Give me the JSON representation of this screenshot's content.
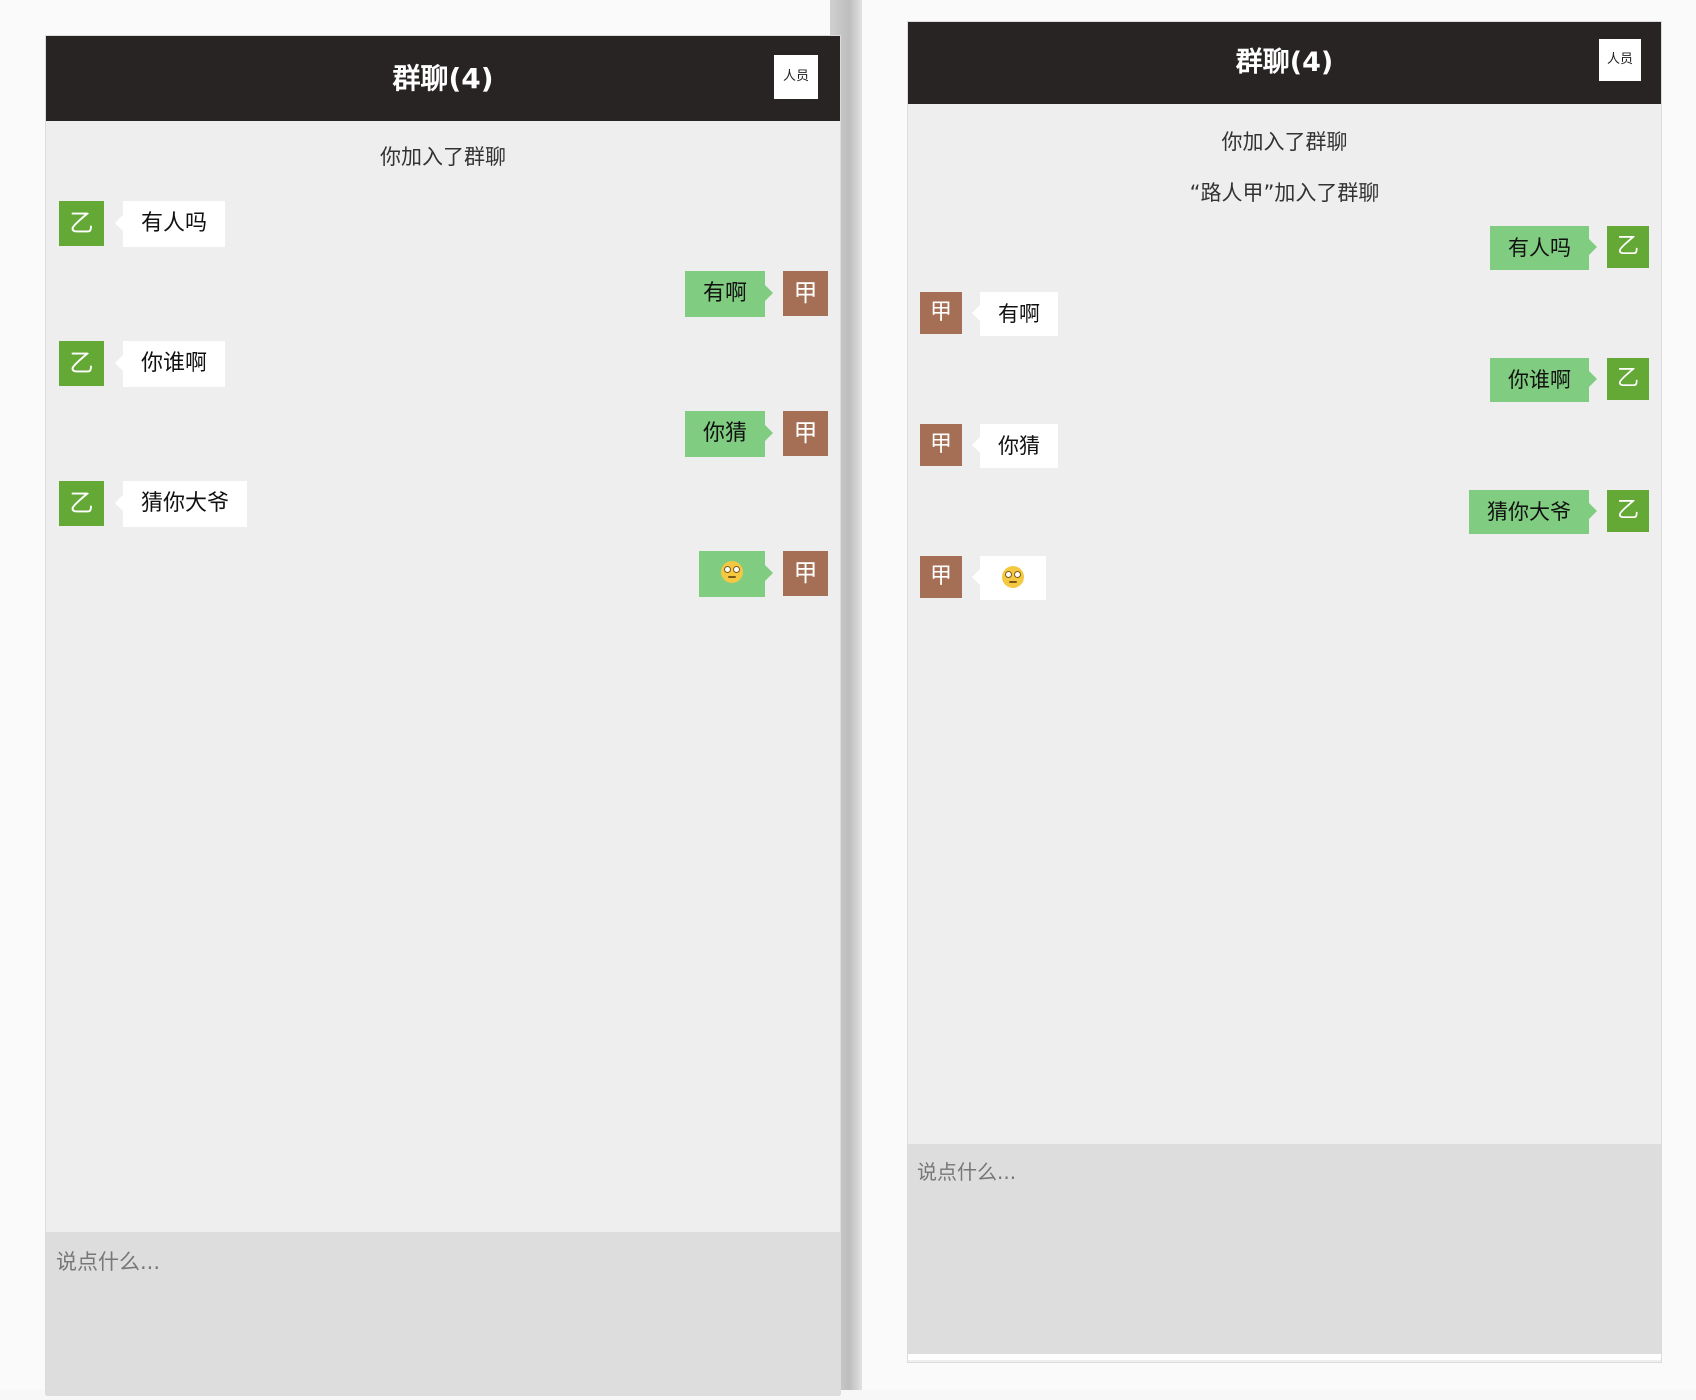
{
  "left_window": {
    "title": "群聊(4)",
    "members_label": "人员",
    "system_messages": [
      "你加入了群聊"
    ],
    "messages": [
      {
        "sender": "乙",
        "side": "in",
        "text": "有人吗"
      },
      {
        "sender": "甲",
        "side": "out",
        "text": "有啊"
      },
      {
        "sender": "乙",
        "side": "in",
        "text": "你谁啊"
      },
      {
        "sender": "甲",
        "side": "out",
        "text": "你猜"
      },
      {
        "sender": "乙",
        "side": "in",
        "text": "猜你大爷"
      },
      {
        "sender": "甲",
        "side": "out",
        "text": "",
        "emoji": "face-with-rolling-eyes-icon"
      }
    ],
    "input_placeholder": "说点什么..."
  },
  "right_window": {
    "title": "群聊(4)",
    "members_label": "人员",
    "system_messages": [
      "你加入了群聊",
      "“路人甲”加入了群聊"
    ],
    "messages": [
      {
        "sender": "乙",
        "side": "out",
        "text": "有人吗"
      },
      {
        "sender": "甲",
        "side": "in",
        "text": "有啊"
      },
      {
        "sender": "乙",
        "side": "out",
        "text": "你谁啊"
      },
      {
        "sender": "甲",
        "side": "in",
        "text": "你猜"
      },
      {
        "sender": "乙",
        "side": "out",
        "text": "猜你大爷"
      },
      {
        "sender": "甲",
        "side": "in",
        "text": "",
        "emoji": "face-with-rolling-eyes-icon"
      }
    ],
    "input_placeholder": "说点什么..."
  },
  "colors": {
    "header_bg": "#282423",
    "chat_bg": "#eeeeee",
    "bubble_out": "#80cc80",
    "bubble_in": "#ffffff",
    "avatar_yi": "#64a835",
    "avatar_jia": "#a56f56",
    "input_bg": "#dddddd"
  }
}
